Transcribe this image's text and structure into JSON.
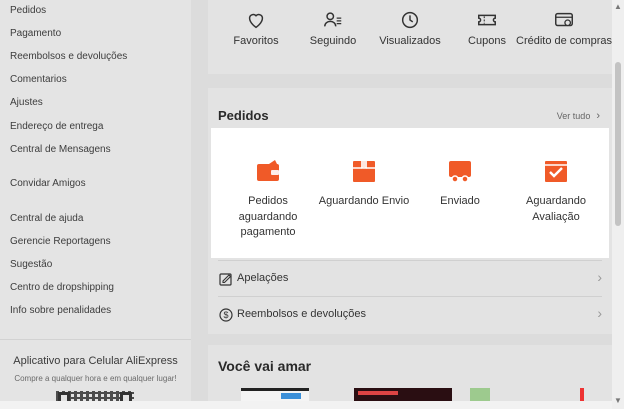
{
  "sidebar": {
    "items": [
      {
        "label": "Pedidos"
      },
      {
        "label": "Pagamento"
      },
      {
        "label": "Reembolsos e devoluções"
      },
      {
        "label": "Comentarios"
      },
      {
        "label": "Ajustes"
      },
      {
        "label": "Endereço de entrega"
      },
      {
        "label": "Central de Mensagens"
      },
      {
        "label": "Convidar Amigos"
      },
      {
        "label": "Central de ajuda"
      },
      {
        "label": "Gerencie Reportagens"
      },
      {
        "label": "Sugestão"
      },
      {
        "label": "Centro de dropshipping"
      },
      {
        "label": "Info sobre penalidades"
      }
    ],
    "app": {
      "title": "Aplicativo para Celular AliExpress",
      "subtitle": "Compre a qualquer hora e em qualquer lugar!"
    }
  },
  "quick_links": [
    {
      "label": "Favoritos",
      "icon": "heart-icon"
    },
    {
      "label": "Seguindo",
      "icon": "user-follow-icon"
    },
    {
      "label": "Visualizados",
      "icon": "clock-icon"
    },
    {
      "label": "Cupons",
      "icon": "coupon-icon"
    },
    {
      "label": "Crédito de compras",
      "icon": "credit-icon"
    }
  ],
  "orders": {
    "title": "Pedidos",
    "see_all": "Ver tudo",
    "statuses": [
      {
        "label": "Pedidos aguardando pagamento",
        "icon": "wallet-icon"
      },
      {
        "label": "Aguardando Envio",
        "icon": "package-icon"
      },
      {
        "label": "Enviado",
        "icon": "truck-icon"
      },
      {
        "label": "Aguardando Avaliação",
        "icon": "review-check-icon"
      }
    ],
    "links": [
      {
        "label": "Apelações",
        "icon": "edit-icon"
      },
      {
        "label": "Reembolsos e devoluções",
        "icon": "refund-icon"
      }
    ]
  },
  "recommend": {
    "title": "Você vai amar"
  },
  "colors": {
    "accent": "#f05a28",
    "highlight_bg": "#ffffff",
    "dim_bg": "#dcdcdc"
  }
}
